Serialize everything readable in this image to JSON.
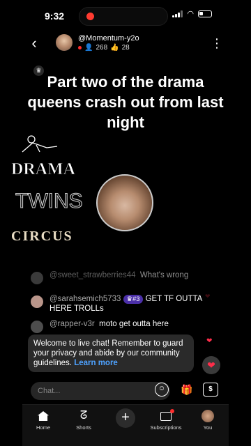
{
  "status_bar": {
    "time": "9:32"
  },
  "header": {
    "channel_name": "@Momentum-y2o",
    "viewers": "268",
    "likes": "28"
  },
  "video": {
    "title": "Part two of the drama queens crash out from last night",
    "logo_text": [
      "DRAMA",
      "TWINS",
      "CIRCUS"
    ]
  },
  "chat": {
    "messages": [
      {
        "user": "@sweet_strawberries44",
        "text": "What's wrong"
      },
      {
        "user": "@sarahsemich5733",
        "badge": "#3",
        "text": "GET TF OUTTA HERE TROLLs"
      },
      {
        "user": "@rapper-v3r",
        "text": "moto get outta here"
      }
    ],
    "welcome_text": "Welcome to live chat! Remember to guard your privacy and abide by our community guidelines.",
    "welcome_link": "Learn more",
    "input_placeholder": "Chat..."
  },
  "bottom_nav": {
    "home": "Home",
    "shorts": "Shorts",
    "subscriptions": "Subscriptions",
    "you": "You"
  },
  "colors": {
    "live": "#ff2d2d",
    "link": "#4ea2ff",
    "badge": "#4b2fa8",
    "heart": "#ff2d4a"
  }
}
